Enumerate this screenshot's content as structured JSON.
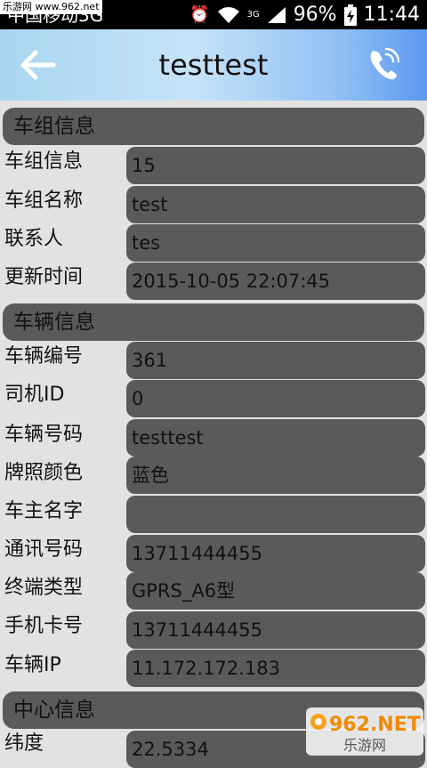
{
  "status_bar": {
    "carrier": "中国移动3G",
    "network_label": "3G",
    "battery": "96%",
    "time": "11:44",
    "watermark": "乐游网 www.962.net"
  },
  "header": {
    "title": "testtest",
    "back_icon": "arrow-left-icon",
    "call_icon": "phone-icon"
  },
  "sections": [
    {
      "title": "车组信息",
      "rows": [
        {
          "label": "车组信息",
          "value": "15"
        },
        {
          "label": "车组名称",
          "value": "test"
        },
        {
          "label": "联系人",
          "value": "tes"
        },
        {
          "label": "更新时间",
          "value": "2015-10-05 22:07:45"
        }
      ]
    },
    {
      "title": "车辆信息",
      "rows": [
        {
          "label": "车辆编号",
          "value": "361"
        },
        {
          "label": "司机ID",
          "value": "0"
        },
        {
          "label": "车辆号码",
          "value": "testtest"
        },
        {
          "label": "牌照颜色",
          "value": "蓝色"
        },
        {
          "label": "车主名字",
          "value": ""
        },
        {
          "label": "通讯号码",
          "value": "13711444455"
        },
        {
          "label": "终端类型",
          "value": "GPRS_A6型"
        },
        {
          "label": "手机卡号",
          "value": "13711444455"
        },
        {
          "label": "车辆IP",
          "value": "11.172.172.183"
        }
      ]
    },
    {
      "title": "中心信息",
      "rows": [
        {
          "label": "纬度",
          "value": "22.5334"
        }
      ]
    }
  ],
  "corner_watermark": {
    "brand": "962.NET",
    "name": "乐游网"
  },
  "colors": {
    "field_bg": "#5a5a5a",
    "page_bg": "#e2e2e2",
    "accent": "#5c98ee"
  }
}
